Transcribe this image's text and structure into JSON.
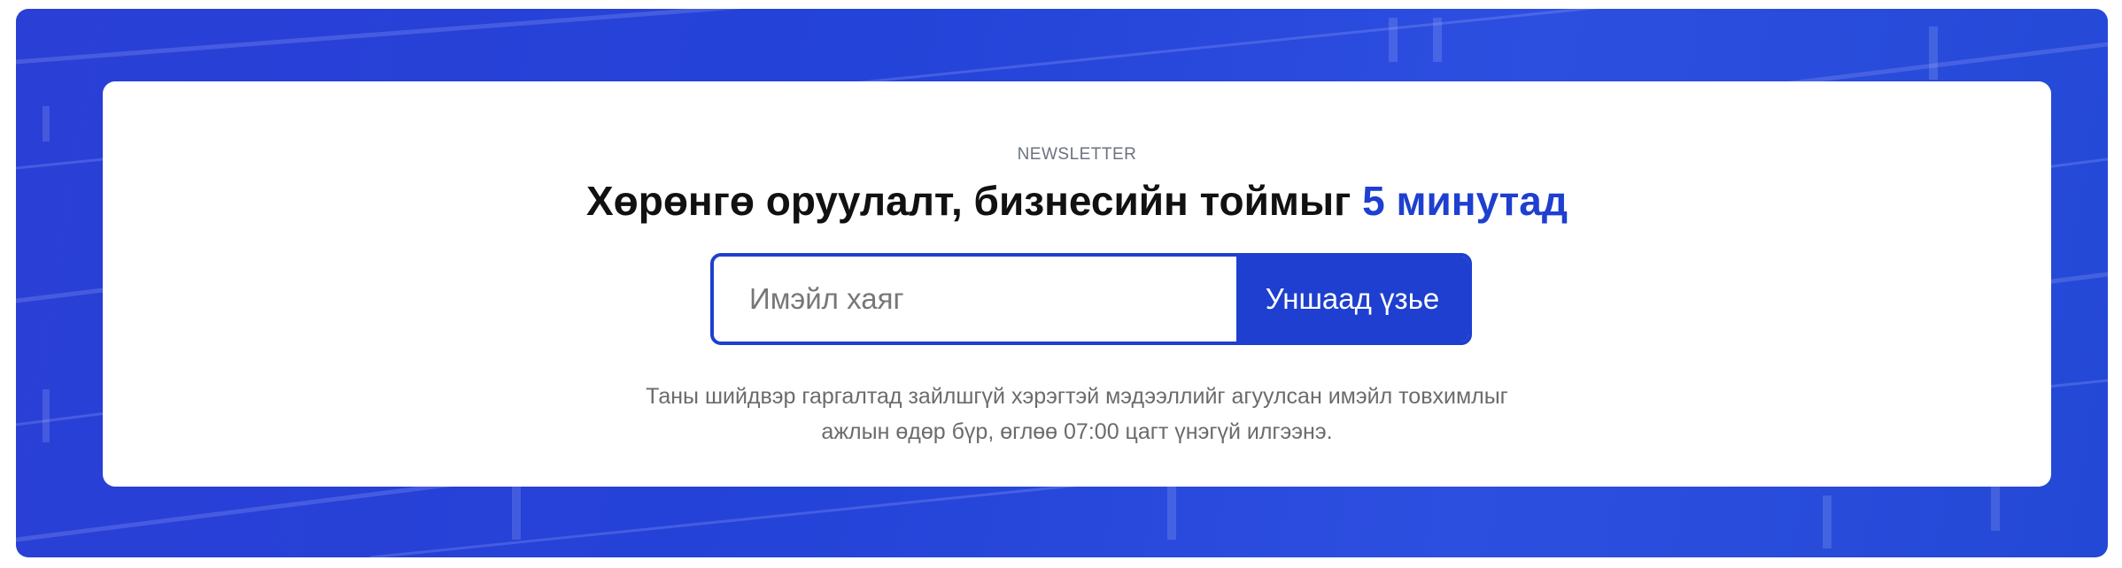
{
  "newsletter": {
    "eyebrow": "NEWSLETTER",
    "headline_main": "Хөрөнгө оруулалт, бизнесийн тоймыг ",
    "headline_accent": "5 минутад",
    "email_placeholder": "Имэйл хаяг",
    "submit_label": "Уншаад үзье",
    "description_line1": "Таны шийдвэр гаргалтад зайлшгүй хэрэгтэй мэдээллийг агуулсан имэйл товхимлыг",
    "description_line2": "ажлын өдөр бүр, өглөө 07:00 цагт үнэгүй илгээнэ."
  },
  "colors": {
    "accent": "#1e3fcf",
    "banner_blue": "#2443d8"
  }
}
